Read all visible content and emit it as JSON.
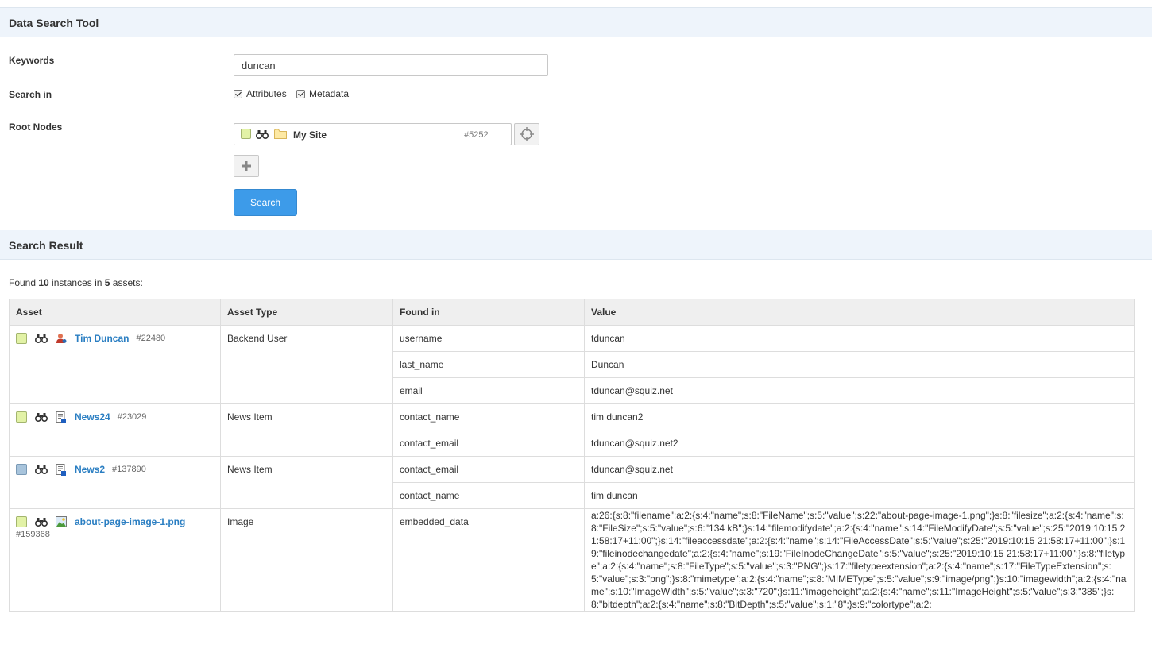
{
  "tool": {
    "title": "Data Search Tool"
  },
  "form": {
    "keywords_label": "Keywords",
    "keywords_value": "duncan",
    "search_in_label": "Search in",
    "attributes_label": "Attributes",
    "metadata_label": "Metadata",
    "root_nodes_label": "Root Nodes",
    "root_node": {
      "name": "My Site",
      "id": "#5252"
    },
    "search_button": "Search"
  },
  "results": {
    "title": "Search Result",
    "summary": {
      "prefix": "Found ",
      "instances": "10",
      "middle": " instances in ",
      "assets": "5",
      "suffix": " assets:"
    },
    "columns": [
      "Asset",
      "Asset Type",
      "Found in",
      "Value"
    ],
    "rows": [
      {
        "asset": "Tim Duncan",
        "id": "#22480",
        "type": "Backend User",
        "status": "green",
        "icon": "user-icon",
        "fields": [
          {
            "found_in": "username",
            "value": "tduncan"
          },
          {
            "found_in": "last_name",
            "value": "Duncan"
          },
          {
            "found_in": "email",
            "value": "tduncan@squiz.net"
          }
        ]
      },
      {
        "asset": "News24",
        "id": "#23029",
        "type": "News Item",
        "status": "green",
        "icon": "news-item-icon",
        "fields": [
          {
            "found_in": "contact_name",
            "value": "tim duncan2"
          },
          {
            "found_in": "contact_email",
            "value": "tduncan@squiz.net2"
          }
        ]
      },
      {
        "asset": "News2",
        "id": "#137890",
        "type": "News Item",
        "status": "blue",
        "icon": "news-item-icon",
        "fields": [
          {
            "found_in": "contact_email",
            "value": "tduncan@squiz.net"
          },
          {
            "found_in": "contact_name",
            "value": "tim duncan"
          }
        ]
      },
      {
        "asset": "about-page-image-1.png",
        "id": "#159368",
        "type": "Image",
        "status": "green",
        "icon": "image-icon",
        "fields": [
          {
            "found_in": "embedded_data",
            "value": "a:26:{s:8:\"filename\";a:2:{s:4:\"name\";s:8:\"FileName\";s:5:\"value\";s:22:\"about-page-image-1.png\";}s:8:\"filesize\";a:2:{s:4:\"name\";s:8:\"FileSize\";s:5:\"value\";s:6:\"134 kB\";}s:14:\"filemodifydate\";a:2:{s:4:\"name\";s:14:\"FileModifyDate\";s:5:\"value\";s:25:\"2019:10:15 21:58:17+11:00\";}s:14:\"fileaccessdate\";a:2:{s:4:\"name\";s:14:\"FileAccessDate\";s:5:\"value\";s:25:\"2019:10:15 21:58:17+11:00\";}s:19:\"fileinodechangedate\";a:2:{s:4:\"name\";s:19:\"FileInodeChangeDate\";s:5:\"value\";s:25:\"2019:10:15 21:58:17+11:00\";}s:8:\"filetype\";a:2:{s:4:\"name\";s:8:\"FileType\";s:5:\"value\";s:3:\"PNG\";}s:17:\"filetypeextension\";a:2:{s:4:\"name\";s:17:\"FileTypeExtension\";s:5:\"value\";s:3:\"png\";}s:8:\"mimetype\";a:2:{s:4:\"name\";s:8:\"MIMEType\";s:5:\"value\";s:9:\"image/png\";}s:10:\"imagewidth\";a:2:{s:4:\"name\";s:10:\"ImageWidth\";s:5:\"value\";s:3:\"720\";}s:11:\"imageheight\";a:2:{s:4:\"name\";s:11:\"ImageHeight\";s:5:\"value\";s:3:\"385\";}s:8:\"bitdepth\";a:2:{s:4:\"name\";s:8:\"BitDepth\";s:5:\"value\";s:1:\"8\";}s:9:\"colortype\";a:2:"
          }
        ]
      }
    ]
  },
  "colors": {
    "accent": "#3d9be9",
    "link": "#2a7ec2",
    "header_bg": "#eef4fb",
    "status_green": "#e2f2a6",
    "status_blue": "#a8c4dc"
  }
}
